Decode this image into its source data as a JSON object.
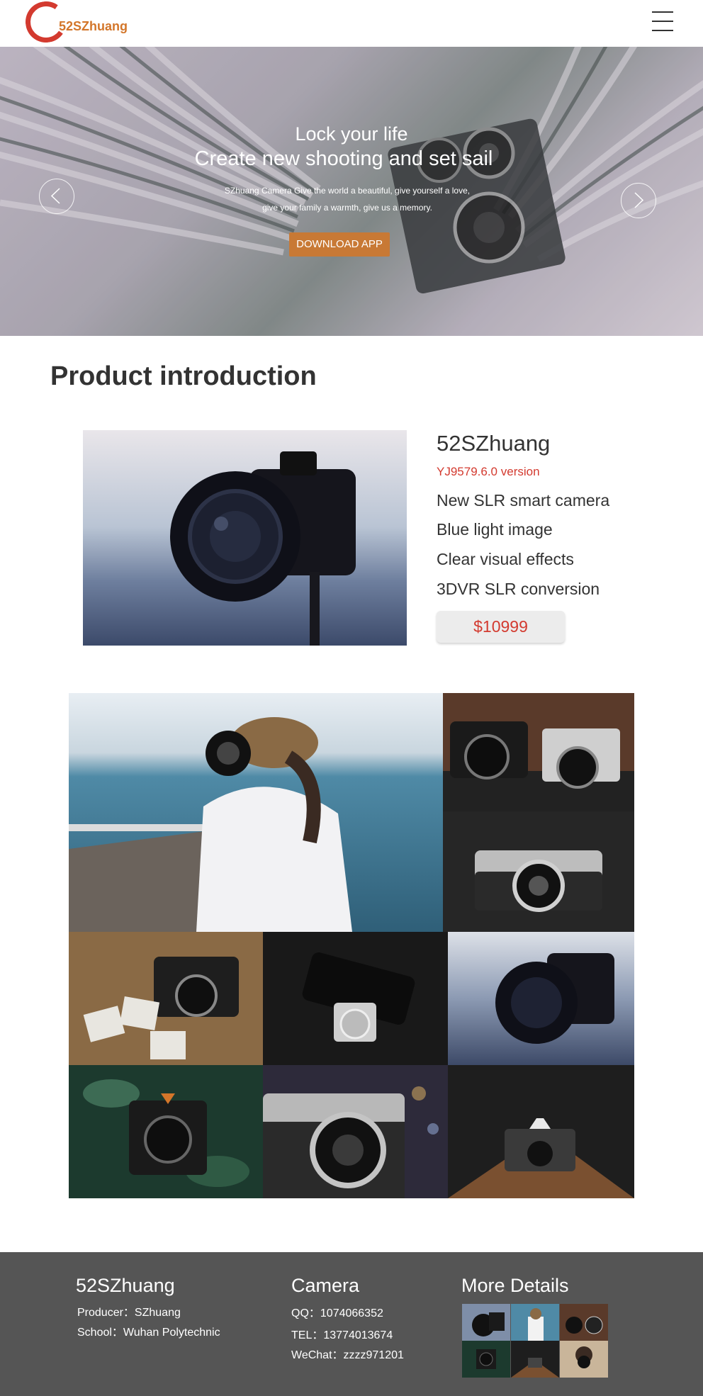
{
  "header": {
    "logo_text": "52SZhuang"
  },
  "hero": {
    "line1": "Lock your life",
    "line2": "Create new shooting and set sail",
    "desc1": "SZhuang Camera Give the world a beautiful, give yourself a love,",
    "desc2": "give your family a warmth, give us a memory.",
    "button": "DOWNLOAD APP"
  },
  "product": {
    "section_title": "Product introduction",
    "name": "52SZhuang",
    "version": "YJ9579.6.0 version",
    "features": [
      "New SLR smart camera",
      "Blue light image",
      "Clear visual effects",
      "3DVR SLR conversion"
    ],
    "price": "$10999"
  },
  "footer": {
    "col1": {
      "title": "52SZhuang",
      "producer": "Producer：SZhuang",
      "school": "School：Wuhan Polytechnic"
    },
    "col2": {
      "title": "Camera",
      "qq": "QQ：1074066352",
      "tel": "TEL：13774013674",
      "wechat": "WeChat：zzzz971201"
    },
    "col3": {
      "title": "More Details"
    }
  },
  "colors": {
    "brand_red": "#d33a2f",
    "brand_orange": "#c87935",
    "footer_bg": "#555555"
  }
}
